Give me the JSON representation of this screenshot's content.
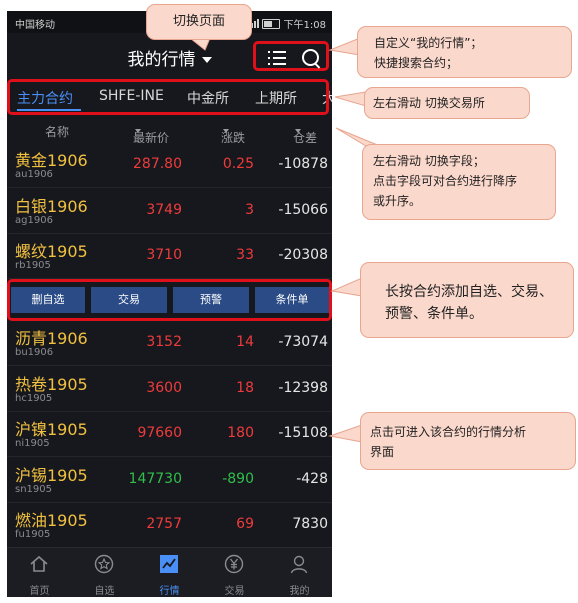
{
  "status_bar": {
    "carrier": "中国移动",
    "time": "下午1:08"
  },
  "header": {
    "title": "我的行情"
  },
  "exchange_tabs": [
    {
      "label": "主力合约",
      "active": true
    },
    {
      "label": "SHFE-INE"
    },
    {
      "label": "中金所"
    },
    {
      "label": "上期所"
    },
    {
      "label": "大"
    }
  ],
  "columns": {
    "name": "名称",
    "price": "最新价",
    "change": "涨跌",
    "position": "仓差"
  },
  "rows_top": [
    {
      "name": "黄金1906",
      "code": "au1906",
      "price": "287.80",
      "change": "0.25",
      "position": "-10878",
      "color": "red"
    },
    {
      "name": "白银1906",
      "code": "ag1906",
      "price": "3749",
      "change": "3",
      "position": "-15066",
      "color": "red"
    },
    {
      "name": "螺纹1905",
      "code": "rb1905",
      "price": "3710",
      "change": "33",
      "position": "-20308",
      "color": "red"
    }
  ],
  "actions": [
    "删自选",
    "交易",
    "预警",
    "条件单"
  ],
  "rows_bottom": [
    {
      "name": "沥青1906",
      "code": "bu1906",
      "price": "3152",
      "change": "14",
      "position": "-73074",
      "color": "red"
    },
    {
      "name": "热卷1905",
      "code": "hc1905",
      "price": "3600",
      "change": "18",
      "position": "-12398",
      "color": "red"
    },
    {
      "name": "沪镍1905",
      "code": "ni1905",
      "price": "97660",
      "change": "180",
      "position": "-15108",
      "color": "red"
    },
    {
      "name": "沪锡1905",
      "code": "sn1905",
      "price": "147730",
      "change": "-890",
      "position": "-428",
      "color": "green"
    },
    {
      "name": "燃油1905",
      "code": "fu1905",
      "price": "2757",
      "change": "69",
      "position": "7830",
      "color": "red"
    }
  ],
  "tab_bar": [
    {
      "label": "首页",
      "icon": "home-icon"
    },
    {
      "label": "自选",
      "icon": "star-icon"
    },
    {
      "label": "行情",
      "icon": "chart-icon",
      "active": true
    },
    {
      "label": "交易",
      "icon": "yuan-icon"
    },
    {
      "label": "我的",
      "icon": "user-icon"
    }
  ],
  "annotations": {
    "switch_page": "切换页面",
    "customize": [
      "自定义“我的行情”；",
      "快捷搜索合约；"
    ],
    "swipe_exchange": "左右滑动  切换交易所",
    "swipe_field": [
      "左右滑动  切换字段；",
      "点击字段可对合约进行降序",
      "或升序。"
    ],
    "long_press": [
      "长按合约添加自选、交易、",
      "预警、条件单。"
    ],
    "tap_row": [
      "点击可进入该合约的行情分析",
      "界面"
    ]
  },
  "colors": {
    "highlight": "#e0101b",
    "callout": "#fbd8cc",
    "accent": "#4a8ff5"
  }
}
